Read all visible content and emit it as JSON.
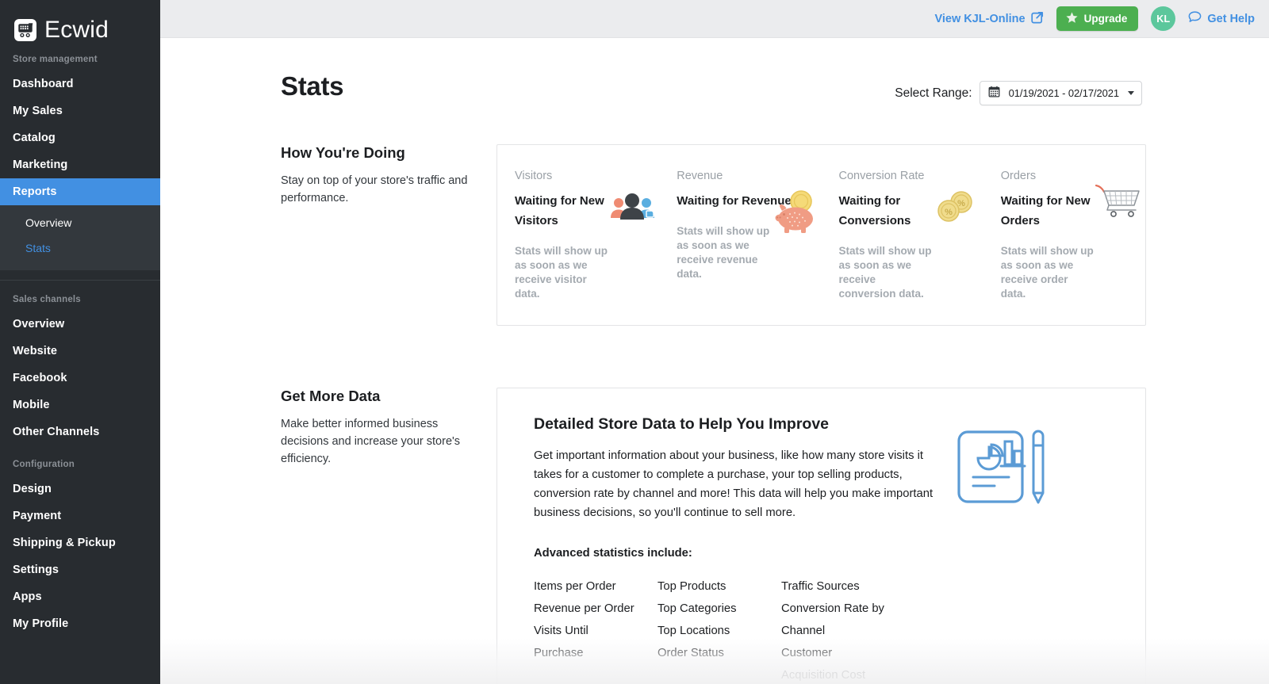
{
  "brand": {
    "name": "Ecwid",
    "logo_icon": "shopping-cart-logo-icon",
    "accent_blue": "#4290e2",
    "sidebar_bg": "#282c30",
    "upgrade_green": "#4caf50",
    "avatar_green": "#5cc79c"
  },
  "sidebar": {
    "groups": [
      {
        "label": "Store management",
        "items": [
          {
            "label": "Dashboard",
            "active": false
          },
          {
            "label": "My Sales",
            "active": false
          },
          {
            "label": "Catalog",
            "active": false
          },
          {
            "label": "Marketing",
            "active": false
          },
          {
            "label": "Reports",
            "active": true
          }
        ],
        "subitems": [
          {
            "label": "Overview",
            "current": false
          },
          {
            "label": "Stats",
            "current": true
          }
        ]
      },
      {
        "label": "Sales channels",
        "items": [
          {
            "label": "Overview",
            "active": false
          },
          {
            "label": "Website",
            "active": false
          },
          {
            "label": "Facebook",
            "active": false
          },
          {
            "label": "Mobile",
            "active": false
          },
          {
            "label": "Other Channels",
            "active": false
          }
        ]
      },
      {
        "label": "Configuration",
        "items": [
          {
            "label": "Design",
            "active": false
          },
          {
            "label": "Payment",
            "active": false
          },
          {
            "label": "Shipping & Pickup",
            "active": false
          },
          {
            "label": "Settings",
            "active": false
          },
          {
            "label": "Apps",
            "active": false
          },
          {
            "label": "My Profile",
            "active": false
          }
        ]
      }
    ]
  },
  "topbar": {
    "view_store_label": "View KJL-Online",
    "view_store_icon": "external-link-icon",
    "upgrade_label": "Upgrade",
    "upgrade_icon": "star-icon",
    "avatar_initials": "KL",
    "get_help_label": "Get Help",
    "get_help_icon": "speech-bubble-icon"
  },
  "page": {
    "title": "Stats",
    "range_label": "Select Range:",
    "range_value": "01/19/2021 - 02/17/2021",
    "range_icon": "calendar-icon",
    "range_caret_icon": "chevron-down-icon"
  },
  "how_youre_doing": {
    "title": "How You're Doing",
    "description": "Stay on top of your store's traffic and performance.",
    "cards": [
      {
        "label": "Visitors",
        "value": "Waiting for New Visitors",
        "note": "Stats will show up as soon as we receive visitor data.",
        "icon": "visitors-people-icon"
      },
      {
        "label": "Revenue",
        "value": "Waiting for Revenue",
        "note": "Stats will show up as soon as we receive revenue data.",
        "icon": "piggy-bank-icon"
      },
      {
        "label": "Conversion Rate",
        "value": "Waiting for Conversions",
        "note": "Stats will show up as soon as we receive conversion data.",
        "icon": "percent-coins-icon"
      },
      {
        "label": "Orders",
        "value": "Waiting for New Orders",
        "note": "Stats will show up as soon as we receive order data.",
        "icon": "shopping-cart-icon"
      }
    ]
  },
  "get_more_data": {
    "title": "Get More Data",
    "description": "Make better informed business decisions and increase your store's efficiency.",
    "panel_title": "Detailed Store Data to Help You Improve",
    "panel_text": "Get important information about your business, like how many store visits it takes for a customer to complete a purchase, your top selling products, conversion rate by channel and more! This data will help you make important business decisions, so you'll continue to sell more.",
    "list_heading": "Advanced statistics include:",
    "art_icon": "report-document-pencil-icon",
    "columns": [
      [
        "Items per Order",
        "Revenue per Order",
        "Visits Until Purchase"
      ],
      [
        "Top Products",
        "Top Categories",
        "Top Locations",
        "Order Status"
      ],
      [
        "Traffic Sources",
        "Conversion Rate by Channel",
        "Customer Acquisition Cost"
      ]
    ]
  }
}
